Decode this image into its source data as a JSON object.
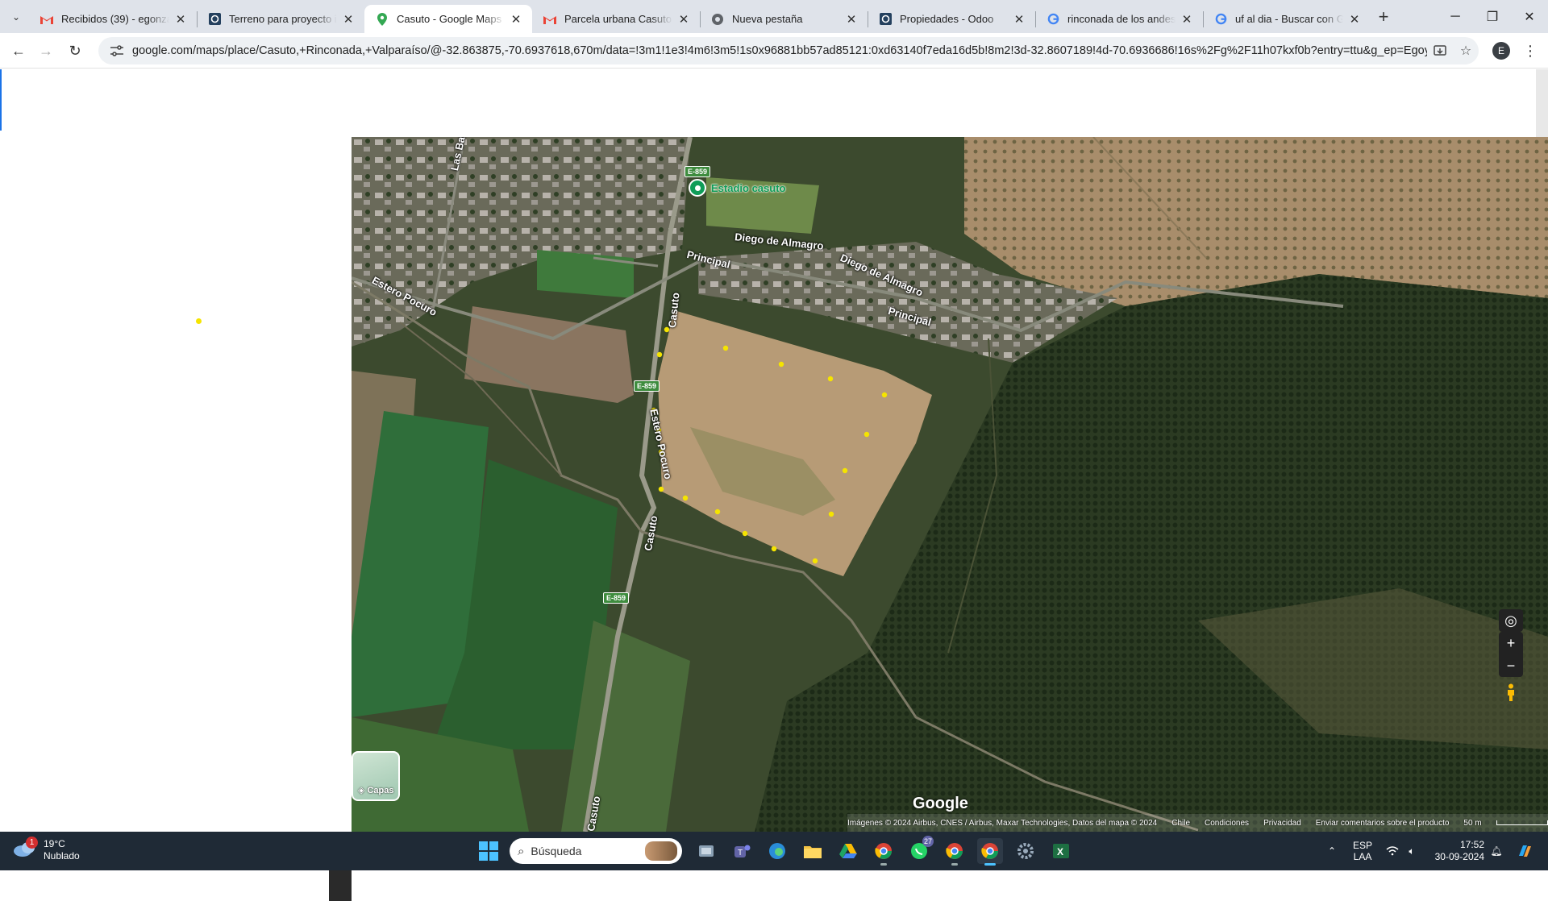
{
  "browser": {
    "tabs": [
      {
        "title": "Recibidos (39) - egonzalez",
        "icon": "gmail-icon",
        "active": false
      },
      {
        "title": "Terreno para proyecto inm",
        "icon": "odoo-icon",
        "active": false
      },
      {
        "title": "Casuto - Google Maps",
        "icon": "maps-pin-icon",
        "active": true
      },
      {
        "title": "Parcela urbana Casuto - R",
        "icon": "gmail-icon",
        "active": false
      },
      {
        "title": "Nueva pestaña",
        "icon": "chrome-icon",
        "active": false
      },
      {
        "title": "Propiedades - Odoo",
        "icon": "odoo-icon",
        "active": false
      },
      {
        "title": "rinconada de los andes y",
        "icon": "google-icon",
        "active": false
      },
      {
        "title": "uf al dia - Buscar con Goo",
        "icon": "google-icon",
        "active": false
      }
    ],
    "new_tab_label": "+",
    "url": "google.com/maps/place/Casuto,+Rinconada,+Valparaíso/@-32.863875,-70.6937618,670m/data=!3m1!1e3!4m6!3m5!1s0x96881bb57ad85121:0xd63140f7eda16d5b!8m2!3d-32.8607189!4d-70.6936686!16s%2Fg%2F11h07kxf0b?entry=ttu&g_ep=EgoyMDI0MD...",
    "profile_initial": "E"
  },
  "map": {
    "poi_label": "Estadio casuto",
    "road_labels": {
      "las_bandurrias": "Las Bandurrias",
      "estero_pocuro_w": "Estero Pocuro",
      "diego_de_almagro_1": "Diego de Almagro",
      "diego_de_almagro_2": "Diego de Almagro",
      "principal_1": "Principal",
      "principal_2": "Principal",
      "casuto_1": "Casuto",
      "casuto_2": "Casuto",
      "casuto_3": "Casuto",
      "estero_pocuro_c": "Estero Pocuro"
    },
    "shields": {
      "s1": "E-859",
      "s2": "E-859",
      "s3": "E-859"
    },
    "layers_label": "Capas",
    "google_logo": "Google",
    "attribution": "Imágenes © 2024 Airbus, CNES / Airbus, Maxar Technologies, Datos del mapa © 2024",
    "links": {
      "country": "Chile",
      "terms": "Condiciones",
      "privacy": "Privacidad",
      "feedback": "Enviar comentarios sobre el producto"
    },
    "scale": "50 m",
    "colors": {
      "marker": "#f5e400",
      "poi": "#0f9d58"
    }
  },
  "taskbar": {
    "weather_temp": "19°C",
    "weather_desc": "Nublado",
    "weather_badge": "1",
    "search_placeholder": "Búsqueda",
    "teams_count": "27",
    "language_top": "ESP",
    "language_bottom": "LAA",
    "time": "17:52",
    "date": "30-09-2024"
  }
}
